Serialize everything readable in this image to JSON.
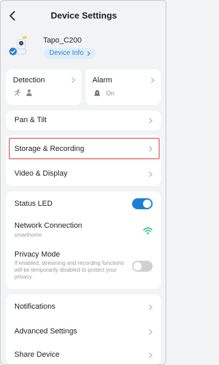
{
  "header": {
    "title": "Device Settings"
  },
  "device": {
    "name": "Tapo_C200",
    "info_label": "Device Info"
  },
  "detection": {
    "label": "Detection"
  },
  "alarm": {
    "label": "Alarm",
    "status": "On"
  },
  "rows": {
    "pan_tilt": "Pan & Tilt",
    "storage_recording": "Storage & Recording",
    "video_display": "Video & Display"
  },
  "status_led": {
    "label": "Status LED",
    "enabled": true
  },
  "network": {
    "label": "Network Connection",
    "ssid": "smarthome"
  },
  "privacy": {
    "label": "Privacy Mode",
    "description": "If enabled, streaming and recording functions will be temporarily disabled to protect your privacy.",
    "enabled": false
  },
  "bottom_rows": {
    "notifications": "Notifications",
    "advanced_settings": "Advanced Settings",
    "share_device": "Share Device"
  },
  "colors": {
    "accent": "#1a7fd6",
    "wifi": "#2fbf8a",
    "highlight": "#d83a3a",
    "toggle_off": "#d0d0d0"
  }
}
